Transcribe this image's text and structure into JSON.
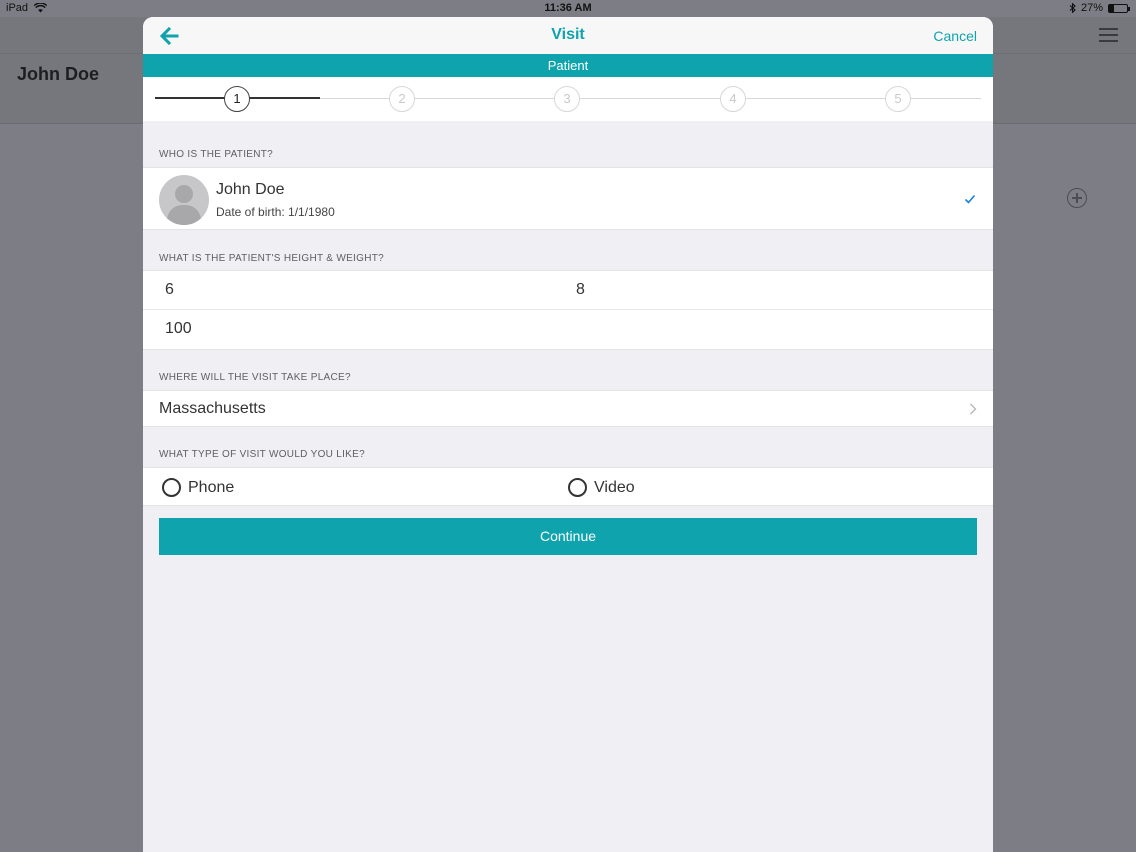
{
  "status_bar": {
    "device": "iPad",
    "time": "11:36 AM",
    "battery": "27%",
    "battery_level": 0.27
  },
  "background": {
    "title": "John Doe"
  },
  "modal": {
    "title": "Visit",
    "cancel": "Cancel",
    "step_title": "Patient",
    "steps": [
      "1",
      "2",
      "3",
      "4",
      "5"
    ],
    "current_step": 1
  },
  "patient_section": {
    "label": "WHO IS THE PATIENT?",
    "name": "John Doe",
    "dob": "Date of birth: 1/1/1980"
  },
  "hw_section": {
    "label": "WHAT IS THE PATIENT'S HEIGHT & WEIGHT?",
    "height_ft": "6",
    "height_in": "8",
    "weight": "100"
  },
  "location_section": {
    "label": "WHERE WILL THE VISIT TAKE PLACE?",
    "value": "Massachusetts"
  },
  "type_section": {
    "label": "WHAT TYPE OF VISIT WOULD YOU LIKE?",
    "options": [
      "Phone",
      "Video"
    ]
  },
  "continue_label": "Continue",
  "colors": {
    "accent": "#0fa3ae",
    "check": "#1a7fe0"
  }
}
